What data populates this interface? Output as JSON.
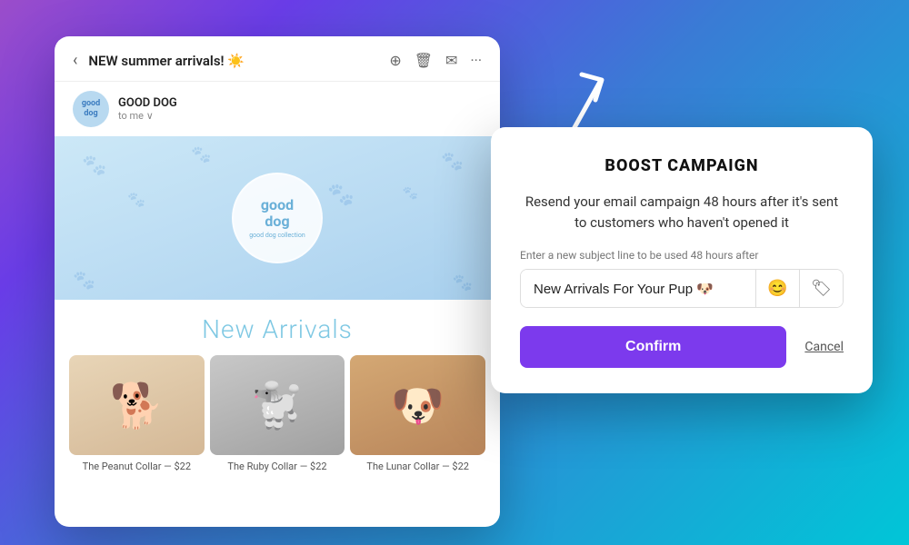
{
  "background": {
    "gradient_description": "purple to teal"
  },
  "email_card": {
    "subject": "NEW summer arrivals! ☀️",
    "back_label": "‹",
    "sender_name": "GOOD DOG",
    "sender_to": "to me ∨",
    "new_arrivals_heading": "New Arrivals",
    "logo_line1": "good",
    "logo_line2": "dog",
    "logo_tagline": "good dog collection",
    "products": [
      {
        "emoji": "🐕",
        "caption": "The Peanut Collar — $22"
      },
      {
        "emoji": "🐩",
        "caption": "The Ruby Collar — $22"
      },
      {
        "emoji": "🐶",
        "caption": "The Lunar Collar — $22"
      }
    ],
    "header_icons": [
      "⊕",
      "🗑",
      "✉",
      "···"
    ]
  },
  "modal": {
    "title": "BOOST CAMPAIGN",
    "description": "Resend your email campaign 48 hours after it's sent to customers who haven't opened it",
    "input_label": "Enter a new subject line to be used 48 hours after",
    "subject_value": "New Arrivals For Your Pup 🐶",
    "emoji_btn_icon": "😊",
    "tag_btn_icon": "🏷",
    "confirm_label": "Confirm",
    "cancel_label": "Cancel"
  }
}
